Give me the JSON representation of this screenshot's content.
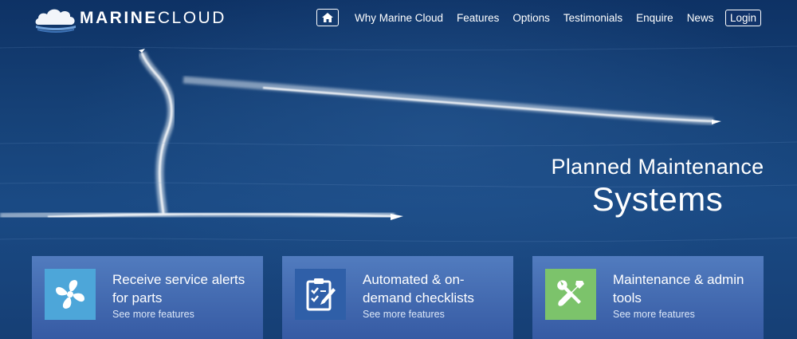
{
  "brand": {
    "bold": "MARINE",
    "light": "CLOUD"
  },
  "nav": {
    "home_icon": "home-icon",
    "items": [
      "Why Marine Cloud",
      "Features",
      "Options",
      "Testimonials",
      "Enquire",
      "News"
    ],
    "login_label": "Login"
  },
  "hero": {
    "line1": "Planned Maintenance",
    "line2": "Systems"
  },
  "features": [
    {
      "title": "Receive service alerts for parts",
      "link": "See more features",
      "icon": "fan-icon",
      "icon_bg": "#4da6d9"
    },
    {
      "title": "Automated & on-demand checklists",
      "link": "See more features",
      "icon": "checklist-icon",
      "icon_bg": "#2f5fa8"
    },
    {
      "title": "Maintenance & admin tools",
      "link": "See more features",
      "icon": "tools-icon",
      "icon_bg": "#7cc36b"
    }
  ]
}
